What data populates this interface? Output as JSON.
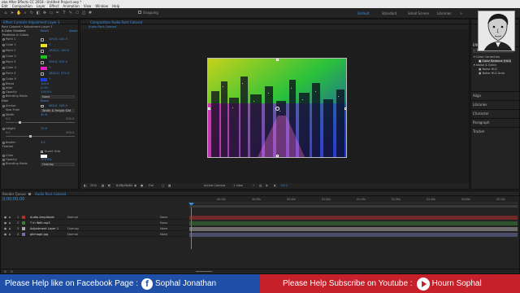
{
  "window": {
    "title": "obe After Effects CC 2018 - Untitled Project.aep *"
  },
  "menu": [
    "Edit",
    "Composition",
    "Layer",
    "Effect",
    "Animation",
    "View",
    "Window",
    "Help"
  ],
  "toolbar": {
    "snapping": "Snapping",
    "workspaces": [
      "Default",
      "Standard",
      "Small Screen",
      "Libraries"
    ]
  },
  "effects_panel": {
    "tab": "Effect Controls Adjustment Layer 1",
    "layer_title": "Rect Colored • Adjustment Layer 1",
    "effect_name": "4-Color Gradient",
    "reset": "Reset",
    "about": "About",
    "group": "Positions & Colors",
    "rows": [
      {
        "label": "Point 1",
        "value": "100.0, 100.0",
        "color": ""
      },
      {
        "label": "Color 1",
        "value": "",
        "color": "#f0e020"
      },
      {
        "label": "Point 2",
        "value": "1820.0, 100.0",
        "color": ""
      },
      {
        "label": "Color 2",
        "value": "",
        "color": "#20c020"
      },
      {
        "label": "Point 3",
        "value": "100.0, 972.0",
        "color": ""
      },
      {
        "label": "Color 3",
        "value": "",
        "color": "#e020c0"
      },
      {
        "label": "Point 4",
        "value": "1820.0, 972.0",
        "color": ""
      },
      {
        "label": "Color 4",
        "value": "",
        "color": "#2040e0"
      }
    ],
    "blend_label": "Blend",
    "blend_value": "100.0",
    "jitter_label": "Jitter",
    "jitter_value": "0.0%",
    "opacity_label": "Opacity",
    "opacity_value": "100.0%",
    "blending_label": "Blending Mode",
    "blending_value": "None",
    "grid_name": "Grid",
    "anchor_label": "Anchor",
    "anchor_value": "960.0, 540.0",
    "size_from_label": "Size From",
    "size_from_value": "Width & Height Slid",
    "width_label": "Width",
    "width_value": "40.0",
    "width_min": "0.0",
    "width_max": "200.0",
    "height_label": "Height",
    "height_value": "70.0",
    "height_min": "0.0",
    "height_max": "200.0",
    "border_label": "Border",
    "border_value": "3.0",
    "feather_label": "Feather",
    "invert_label": "Invert Grid",
    "color_label": "Color",
    "grid_opacity_label": "Opacity",
    "grid_opacity_value": "100.0%",
    "grid_blending_label": "Blending Mode",
    "grid_blending_value": "Overlay"
  },
  "composition": {
    "tab": "Composition Audio Rect Colored",
    "flow_tab": "Audio Rect Colored",
    "zoom": "25%",
    "timecode": "0;00;00;00",
    "resolution": "Full",
    "camera": "Active Camera",
    "views": "1 View",
    "exposure": "+0.0"
  },
  "right_panel": {
    "effects_presets": "Effects & Presets",
    "search_value": "No",
    "tree": [
      {
        "label": "Color Correction",
        "kind": "folder"
      },
      {
        "label": "Color Balance (HLS)",
        "kind": "item"
      },
      {
        "label": "Noise & Grain",
        "kind": "folder"
      },
      {
        "label": "Noise HLS",
        "kind": "item"
      },
      {
        "label": "Noise HLS Auto",
        "kind": "item"
      }
    ],
    "panels": [
      "Align",
      "Libraries",
      "Character",
      "Paragraph",
      "Tracker"
    ]
  },
  "timeline": {
    "render_queue_tab": "Render Queue",
    "comp_tab": "Audio Rect Colored",
    "timecode": "0;00;00;00",
    "layers": [
      {
        "num": "1",
        "name": "Audio Amplitude",
        "mode": "Normal",
        "parent": "None",
        "color": "#b03030"
      },
      {
        "num": "2",
        "name": "T In Well.mp3",
        "mode": "",
        "parent": "None",
        "color": "#3a7a3a"
      },
      {
        "num": "3",
        "name": "Adjustment Layer 1",
        "mode": "Overlay",
        "parent": "None",
        "color": "#a8a8a8"
      },
      {
        "num": "4",
        "name": "gllimage.jpg",
        "mode": "Normal",
        "parent": "None",
        "color": "#7070a8"
      }
    ],
    "ruler": [
      "00:15s",
      "00:30s",
      "00:45s",
      "01:00s",
      "01:15s",
      "01:30s",
      "01:45s",
      "02:00s",
      "02:15s"
    ]
  },
  "banner": {
    "left_text": "Please Help like on Facebook Page :",
    "left_name": "Sophal Jonathan",
    "right_text": "Please Help Subscribe on Youtube :",
    "right_name": "Hourn Sophal",
    "left_bg": "#1f4fa6",
    "right_bg": "#c6202a"
  }
}
